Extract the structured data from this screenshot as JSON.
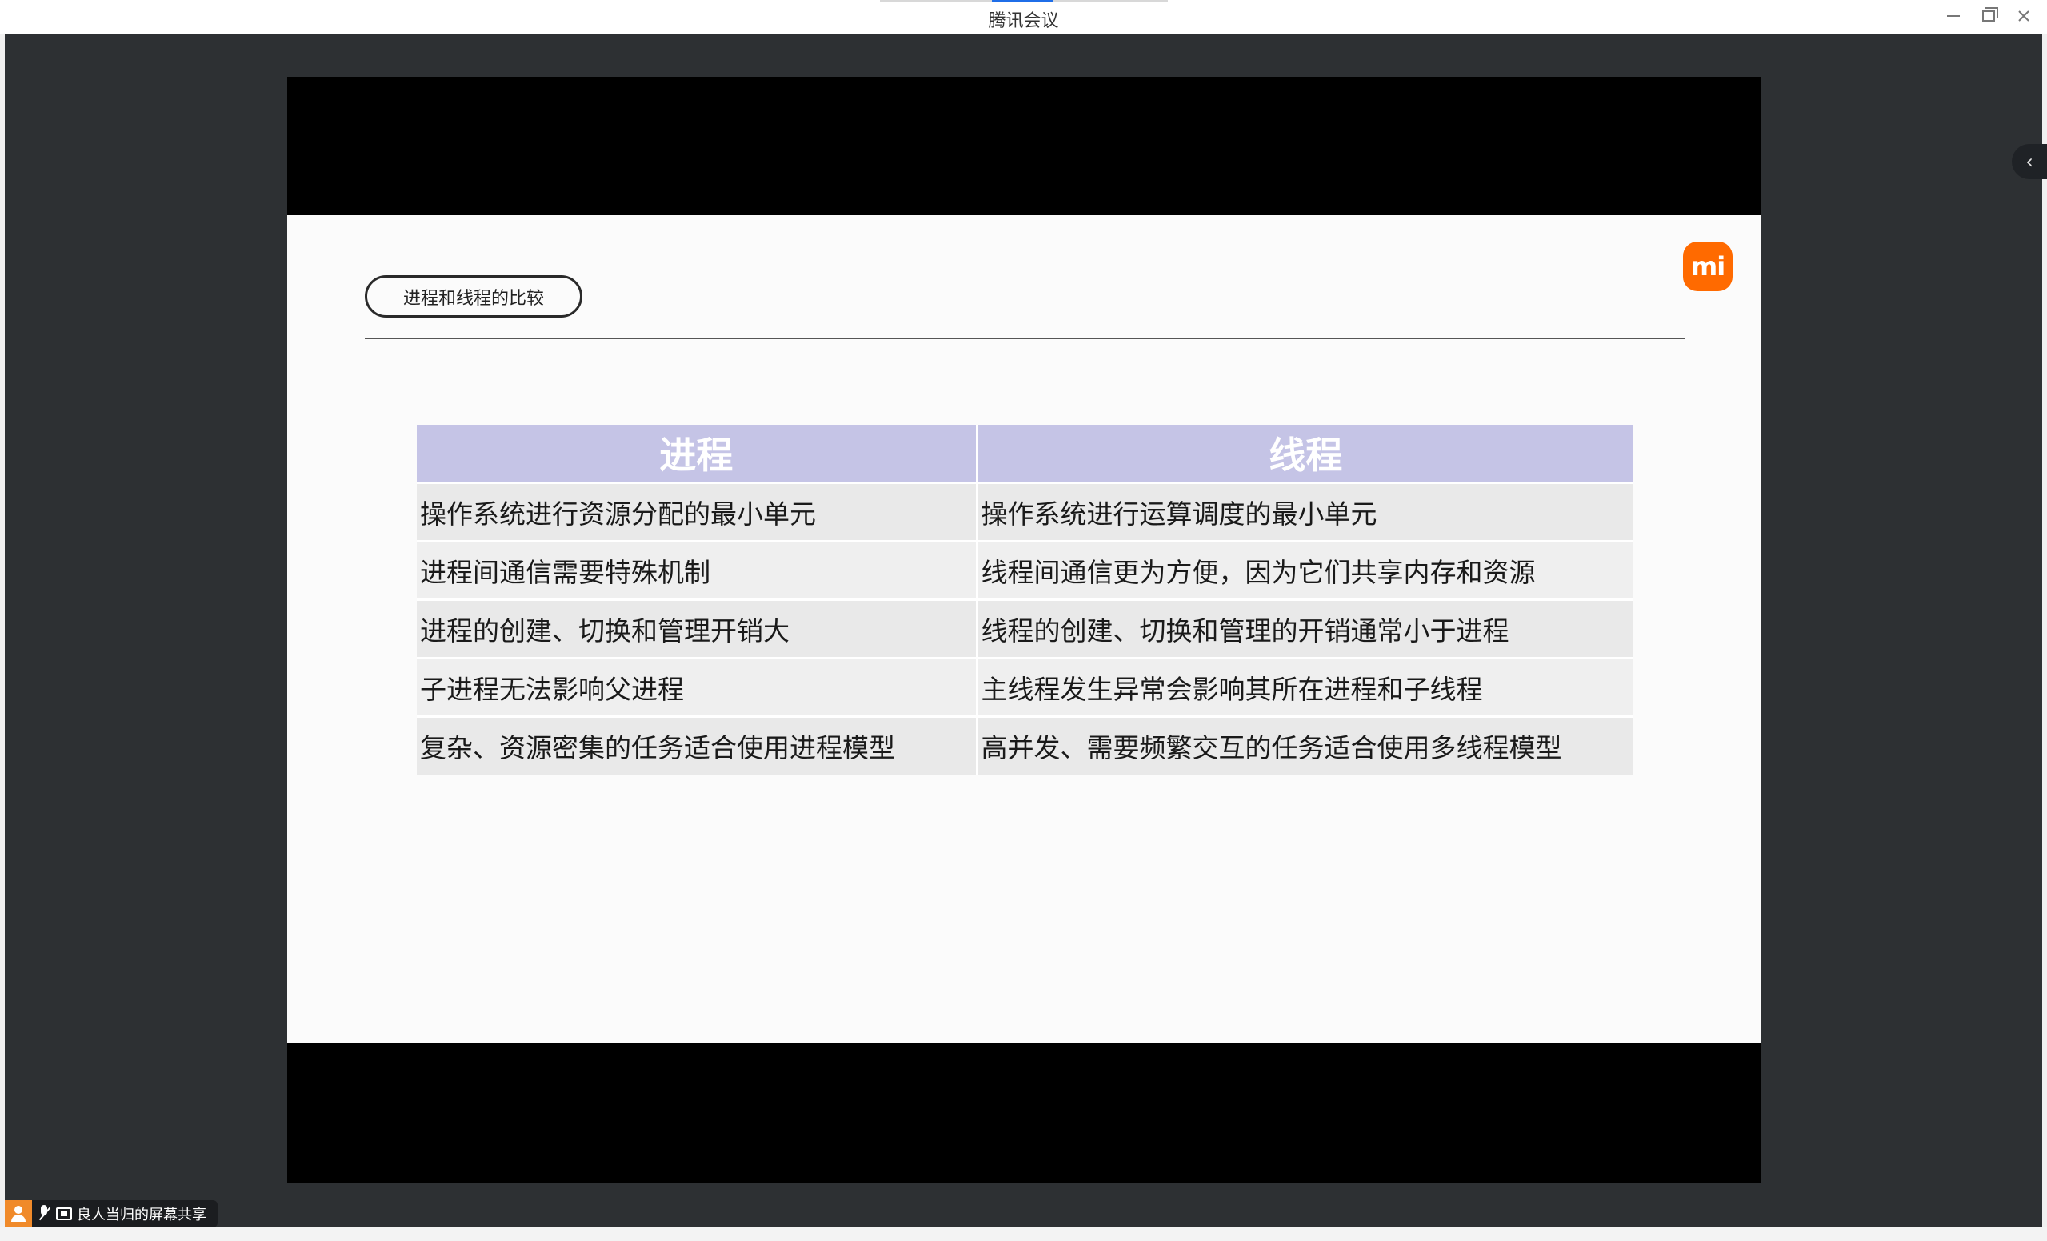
{
  "app": {
    "title": "腾讯会议"
  },
  "window_controls": {
    "minimize_icon": "minimize-icon",
    "maximize_icon": "restore-icon",
    "close_icon": "close-icon"
  },
  "slide": {
    "section_title": "进程和线程的比较",
    "logo_text": "mi",
    "table": {
      "headers": [
        "进程",
        "线程"
      ],
      "rows": [
        [
          "操作系统进行资源分配的最小单元",
          "操作系统进行运算调度的最小单元"
        ],
        [
          "进程间通信需要特殊机制",
          "线程间通信更为方便，因为它们共享内存和资源"
        ],
        [
          "进程的创建、切换和管理开销大",
          "线程的创建、切换和管理的开销通常小于进程"
        ],
        [
          "子进程无法影响父进程",
          "主线程发生异常会影响其所在进程和子线程"
        ],
        [
          "复杂、资源密集的任务适合使用进程模型",
          "高并发、需要频繁交互的任务适合使用多线程模型"
        ]
      ]
    }
  },
  "side_panel": {
    "toggle_icon": "chevron-left-icon",
    "toggle_glyph": "‹"
  },
  "share_indicator": {
    "label": "良人当归的屏幕共享"
  },
  "colors": {
    "header_bg": "#c5c4e6",
    "logo_bg": "#ff6a00",
    "avatar_bg": "#f08a2a",
    "tab_accent": "#1f6ee8"
  }
}
